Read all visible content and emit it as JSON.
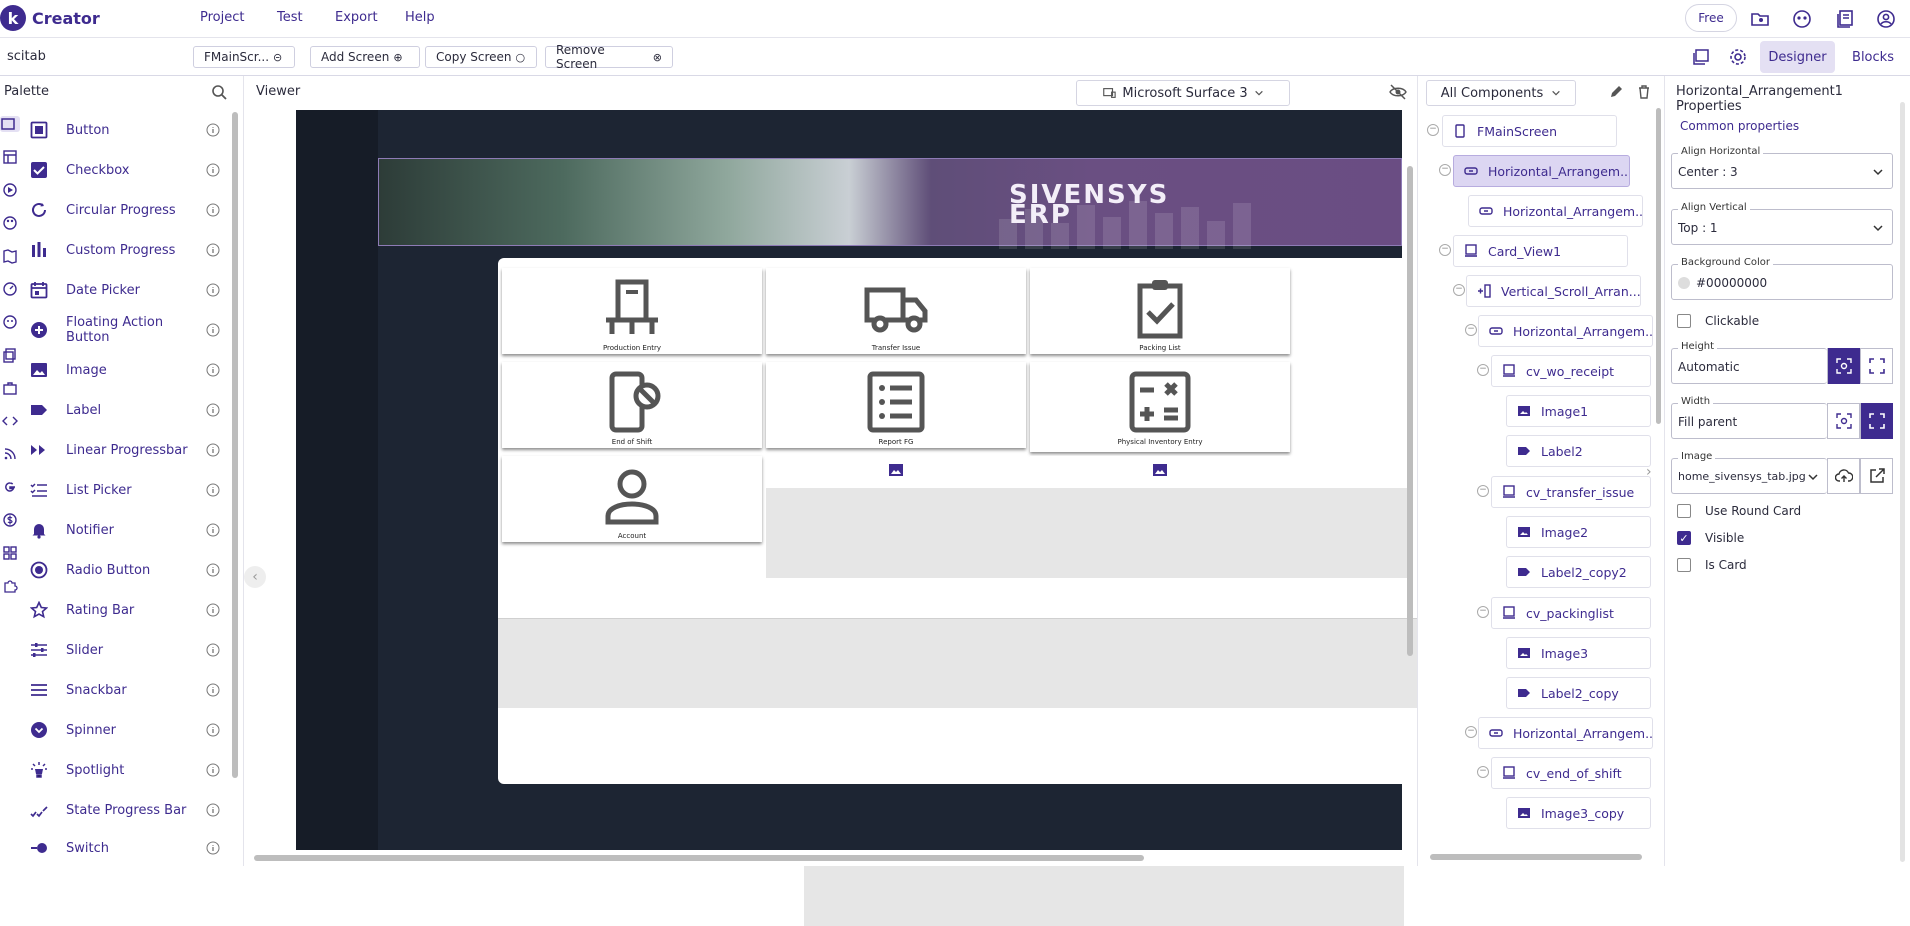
{
  "app": {
    "brand": "Creator",
    "logo_letter": "k",
    "accent": "#3e2b8f"
  },
  "top_menu": [
    "Project",
    "Test",
    "Export",
    "Help"
  ],
  "plan_button": "Free",
  "toolbar": {
    "project_name": "scitab",
    "screen_select": "FMainScr...",
    "add_screen": "Add Screen",
    "copy_screen": "Copy Screen",
    "remove_screen": "Remove Screen",
    "designer_tab": "Designer",
    "blocks_tab": "Blocks"
  },
  "palette": {
    "title": "Palette",
    "items": [
      "Button",
      "Checkbox",
      "Circular Progress",
      "Custom Progress",
      "Date Picker",
      "Floating Action Button",
      "Image",
      "Label",
      "Linear Progressbar",
      "List Picker",
      "Notifier",
      "Radio Button",
      "Rating Bar",
      "Slider",
      "Snackbar",
      "Spinner",
      "Spotlight",
      "State Progress Bar",
      "Switch"
    ]
  },
  "viewer": {
    "title": "Viewer",
    "device": "Microsoft Surface 3",
    "banner_line1": "SIVENSYS",
    "banner_line2": "ERP",
    "tiles": [
      "Production Entry",
      "Transfer Issue",
      "Packing List",
      "End of Shift",
      "Report FG",
      "Physical Inventory Entry",
      "Account"
    ]
  },
  "tree": {
    "filter": "All Components",
    "nodes": [
      "FMainScreen",
      "Horizontal_Arrangem...",
      "Horizontal_Arrangem...",
      "Card_View1",
      "Vertical_Scroll_Arran...",
      "Horizontal_Arrangem...",
      "cv_wo_receipt",
      "Image1",
      "Label2",
      "cv_transfer_issue",
      "Image2",
      "Label2_copy2",
      "cv_packinglist",
      "Image3",
      "Label2_copy",
      "Horizontal_Arrangem...",
      "cv_end_of_shift",
      "Image3_copy"
    ]
  },
  "properties": {
    "title": "Horizontal_Arrangement1 Properties",
    "section": "Common properties",
    "align_h_label": "Align Horizontal",
    "align_h_value": "Center : 3",
    "align_v_label": "Align Vertical",
    "align_v_value": "Top : 1",
    "bg_label": "Background Color",
    "bg_value": "#00000000",
    "clickable": "Clickable",
    "height_label": "Height",
    "height_value": "Automatic",
    "width_label": "Width",
    "width_value": "Fill parent",
    "image_label": "Image",
    "image_value": "home_sivensys_tab.jpg",
    "use_round_card": "Use Round Card",
    "visible": "Visible",
    "is_card": "Is Card"
  }
}
